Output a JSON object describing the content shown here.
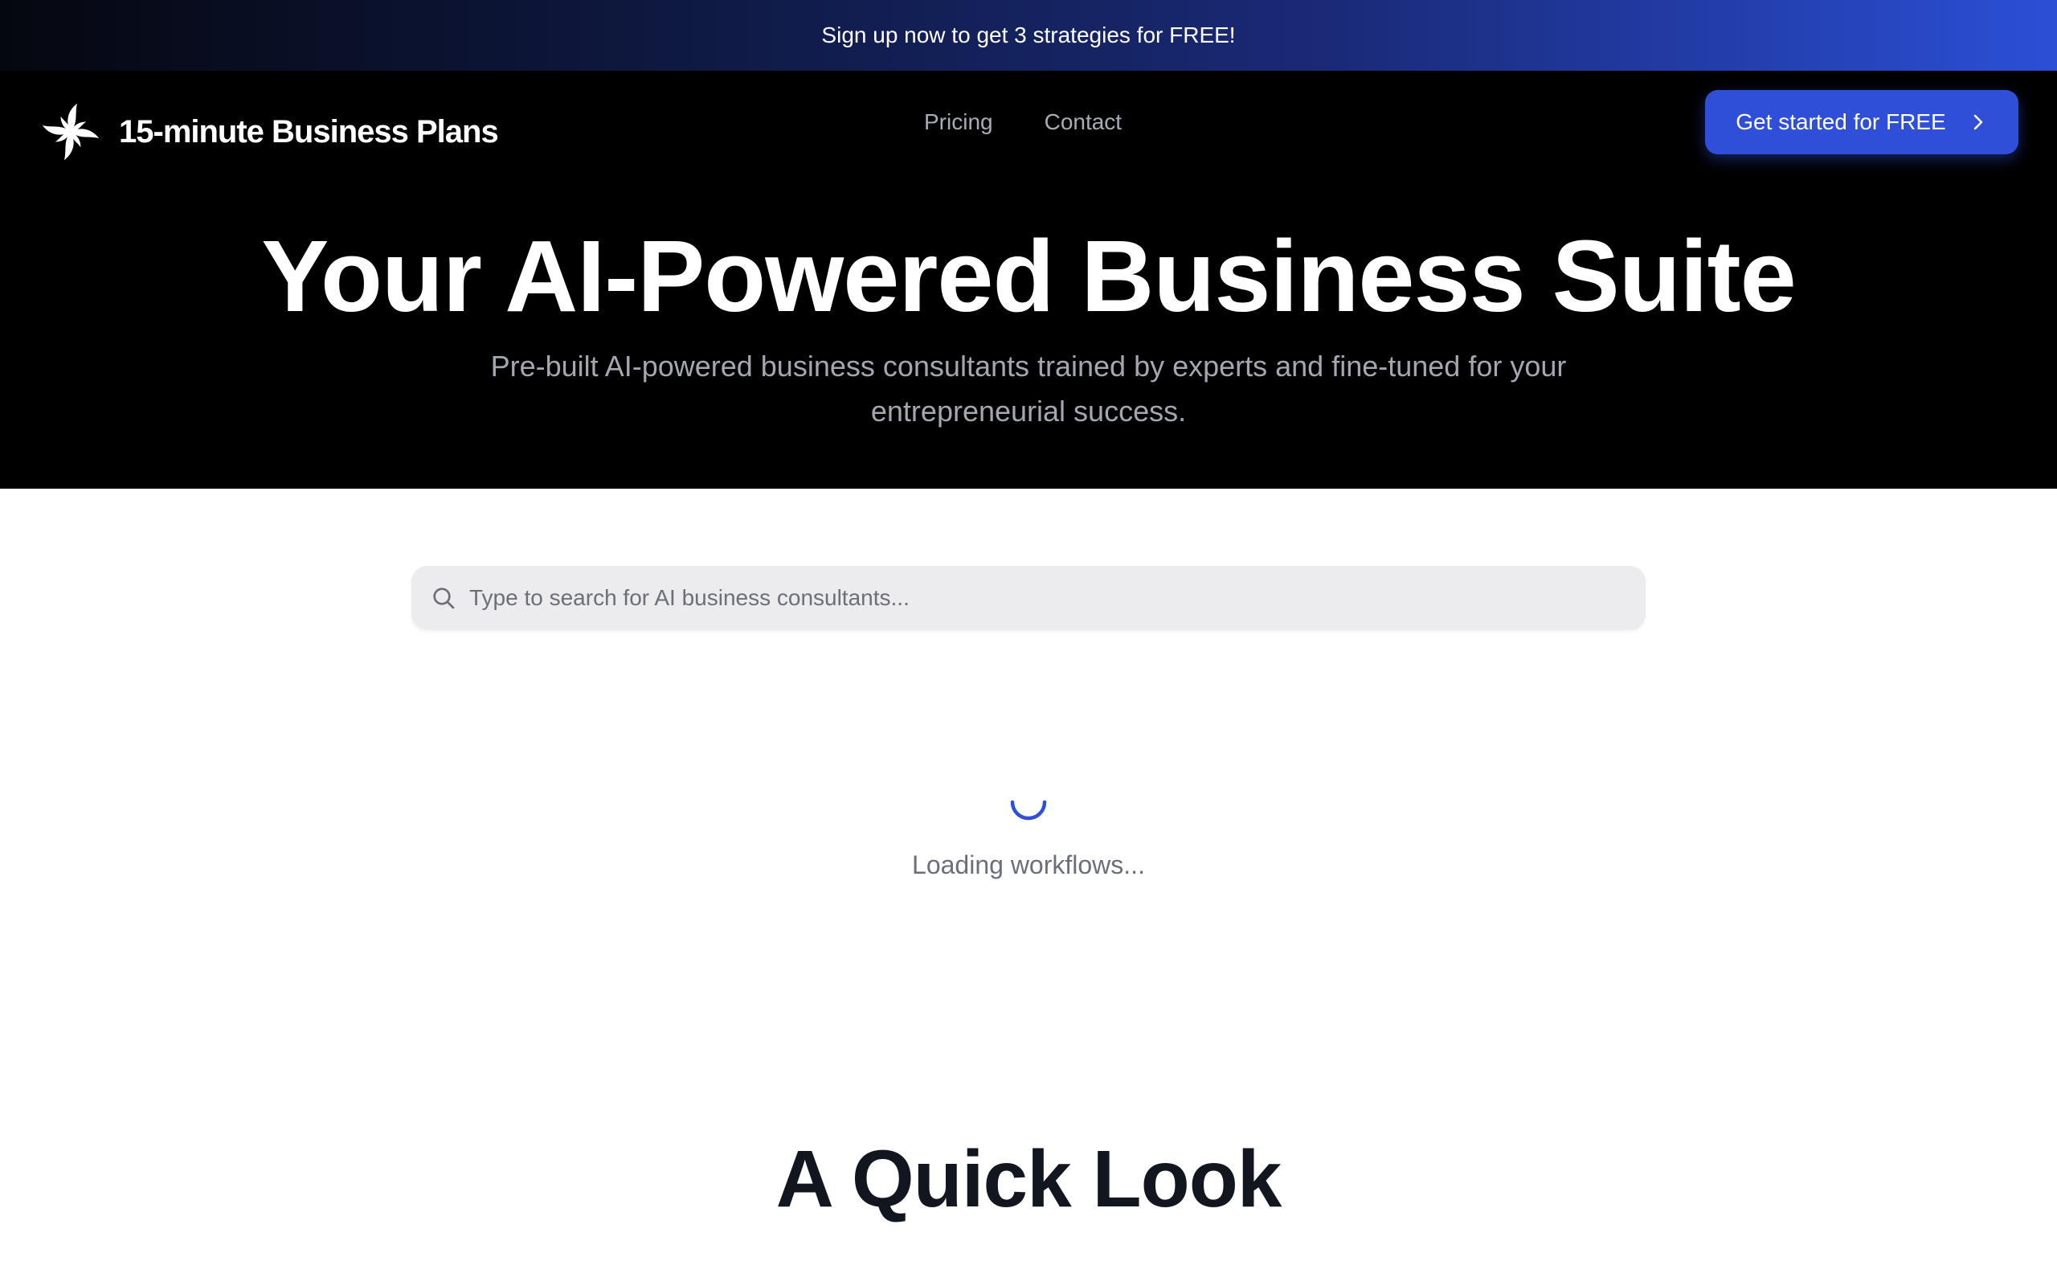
{
  "promo_banner": {
    "text": "Sign up now to get 3 strategies for FREE!"
  },
  "header": {
    "logo_icon": "pinwheel-logo-icon",
    "logo_text": "15-minute Business Plans",
    "nav": [
      {
        "label": "Pricing"
      },
      {
        "label": "Contact"
      }
    ],
    "cta_label": "Get started for FREE",
    "cta_icon": "chevron-right-icon"
  },
  "hero": {
    "title": "Your AI-Powered Business Suite",
    "subtitle": "Pre-built AI-powered business consultants trained by experts and fine-tuned for your entrepreneurial success."
  },
  "search": {
    "icon": "search-icon",
    "placeholder": "Type to search for AI business consultants...",
    "value": ""
  },
  "loading": {
    "icon": "loading-spinner-icon",
    "text": "Loading workflows..."
  },
  "quick_look": {
    "title": "A Quick Look"
  },
  "colors": {
    "accent": "#2f4fd8",
    "hero_background": "#000000",
    "page_background": "#ffffff",
    "banner_gradient_end": "#2b4fd6"
  }
}
